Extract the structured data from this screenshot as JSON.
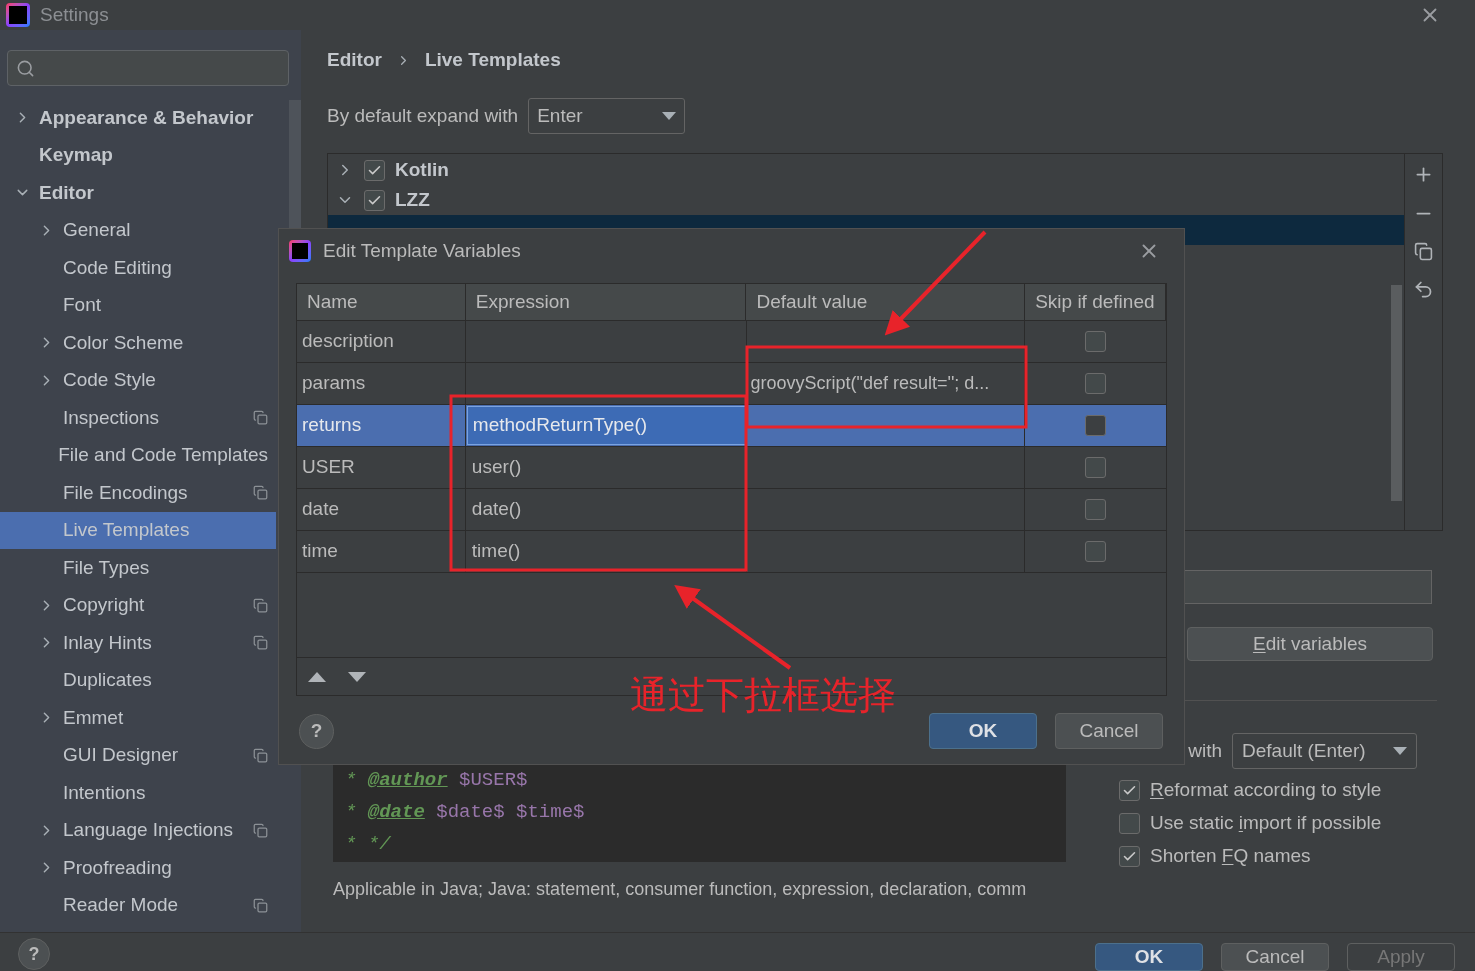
{
  "window": {
    "title": "Settings"
  },
  "sidebar": {
    "items": [
      {
        "label": "Appearance & Behavior",
        "expanded": false,
        "selected": false,
        "project_scoped": false
      },
      {
        "label": "Keymap",
        "selected": false,
        "project_scoped": false
      },
      {
        "label": "Editor",
        "expanded": true,
        "selected": false,
        "project_scoped": false,
        "children": [
          {
            "label": "General",
            "expanded": false,
            "selected": false,
            "project_scoped": false
          },
          {
            "label": "Code Editing",
            "selected": false,
            "project_scoped": false
          },
          {
            "label": "Font",
            "selected": false,
            "project_scoped": false
          },
          {
            "label": "Color Scheme",
            "expanded": false,
            "selected": false,
            "project_scoped": false
          },
          {
            "label": "Code Style",
            "expanded": false,
            "selected": false,
            "project_scoped": false
          },
          {
            "label": "Inspections",
            "selected": false,
            "project_scoped": true
          },
          {
            "label": "File and Code Templates",
            "selected": false,
            "project_scoped": false
          },
          {
            "label": "File Encodings",
            "selected": false,
            "project_scoped": true
          },
          {
            "label": "Live Templates",
            "selected": true,
            "project_scoped": false
          },
          {
            "label": "File Types",
            "selected": false,
            "project_scoped": false
          },
          {
            "label": "Copyright",
            "expanded": false,
            "selected": false,
            "project_scoped": true
          },
          {
            "label": "Inlay Hints",
            "expanded": false,
            "selected": false,
            "project_scoped": true
          },
          {
            "label": "Duplicates",
            "selected": false,
            "project_scoped": false
          },
          {
            "label": "Emmet",
            "expanded": false,
            "selected": false,
            "project_scoped": false
          },
          {
            "label": "GUI Designer",
            "selected": false,
            "project_scoped": true
          },
          {
            "label": "Intentions",
            "selected": false,
            "project_scoped": false
          },
          {
            "label": "Language Injections",
            "expanded": false,
            "selected": false,
            "project_scoped": true
          },
          {
            "label": "Proofreading",
            "expanded": false,
            "selected": false,
            "project_scoped": false
          },
          {
            "label": "Reader Mode",
            "selected": false,
            "project_scoped": true
          }
        ]
      }
    ]
  },
  "breadcrumb": [
    "Editor",
    "Live Templates"
  ],
  "expand_with": {
    "label": "By default expand with",
    "value": "Enter"
  },
  "template_groups": [
    {
      "label": "Kotlin",
      "checked": true,
      "expanded": false
    },
    {
      "label": "LZZ",
      "checked": true,
      "expanded": true
    }
  ],
  "edit_variables_button": {
    "label_parts": [
      {
        "text": "E",
        "underline": true
      },
      {
        "text": "dit variables",
        "underline": false
      }
    ]
  },
  "options": {
    "expand_label": "with",
    "expand_value": "Default (Enter)",
    "checkboxes": [
      {
        "label_parts": [
          {
            "text": "R",
            "underline": true
          },
          {
            "text": "eformat according to style",
            "underline": false
          }
        ],
        "checked": true
      },
      {
        "label_parts": [
          {
            "text": "Use static ",
            "underline": false
          },
          {
            "text": "i",
            "underline": true
          },
          {
            "text": "mport if possible",
            "underline": false
          }
        ],
        "checked": false
      },
      {
        "label_parts": [
          {
            "text": "Shorten ",
            "underline": false
          },
          {
            "text": "F",
            "underline": true
          },
          {
            "text": "Q names",
            "underline": false
          }
        ],
        "checked": true
      }
    ]
  },
  "code_lines": [
    [
      {
        "text": "* ",
        "kind": "comment"
      },
      {
        "text": "@author",
        "kind": "tag"
      },
      {
        "text": " $USER$",
        "kind": "variable"
      }
    ],
    [
      {
        "text": "* ",
        "kind": "comment"
      },
      {
        "text": "@date",
        "kind": "tag"
      },
      {
        "text": " $date$ $time$",
        "kind": "variable"
      }
    ],
    [
      {
        "text": "* */",
        "kind": "comment"
      }
    ]
  ],
  "applicable": "Applicable in Java; Java: statement, consumer function, expression, declaration, comm",
  "footer": {
    "help": "?",
    "buttons": [
      {
        "label": "OK",
        "kind": "default"
      },
      {
        "label": "Cancel",
        "kind": "normal"
      },
      {
        "label": "Apply",
        "kind": "disabled"
      }
    ]
  },
  "dialog": {
    "title": "Edit Template Variables",
    "columns": [
      "Name",
      "Expression",
      "Default value",
      "Skip if defined"
    ],
    "rows": [
      {
        "name": "description",
        "skip": false,
        "selected": false
      },
      {
        "name": "params",
        "default_value": "groovyScript(\"def result=''; d...",
        "skip": false,
        "selected": false
      },
      {
        "name": "returns",
        "expression": "methodReturnType()",
        "skip": false,
        "selected": true
      },
      {
        "name": "USER",
        "expression": "user()",
        "skip": false,
        "selected": false
      },
      {
        "name": "date",
        "expression": "date()",
        "skip": false,
        "selected": false
      },
      {
        "name": "time",
        "expression": "time()",
        "skip": false,
        "selected": false
      }
    ],
    "help": "?",
    "buttons": [
      {
        "label": "OK",
        "kind": "default"
      },
      {
        "label": "Cancel",
        "kind": "normal"
      }
    ]
  },
  "annotation": {
    "text": "通过下拉框选择"
  }
}
